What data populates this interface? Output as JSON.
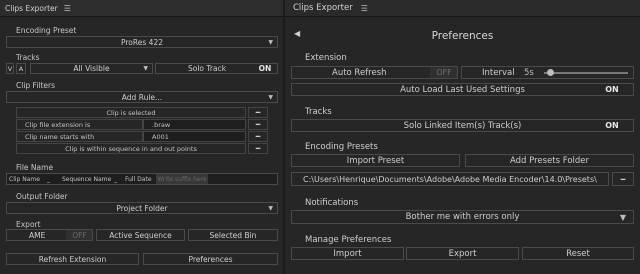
{
  "left": {
    "title": "Clips Exporter",
    "menu_glyph": "☰",
    "encoding_preset": {
      "label": "Encoding Preset",
      "value": "ProRes 422"
    },
    "tracks": {
      "label": "Tracks",
      "video": "V",
      "audio": "A",
      "visibility": "All Visible",
      "solo_label": "Solo Track",
      "solo_state": "ON"
    },
    "clip_filters": {
      "label": "Clip Filters",
      "add_rule": "Add Rule...",
      "rules": [
        {
          "text": "Clip is selected",
          "value": ""
        },
        {
          "text": "Clip file extension is",
          "value": ".braw"
        },
        {
          "text": "Clip name starts with",
          "value": "A001"
        },
        {
          "text": "Clip is within sequence in and out points",
          "value": ""
        }
      ],
      "remove_glyph": "━"
    },
    "file_name": {
      "label": "File Name",
      "tokens": [
        "Clip Name",
        "_",
        "Sequence Name",
        "_",
        "Full Date"
      ],
      "placeholder": "Write suffix here"
    },
    "output_folder": {
      "label": "Output Folder",
      "value": "Project Folder"
    },
    "export": {
      "label": "Export",
      "ame_label": "AME",
      "ame_state": "OFF",
      "active_sequence": "Active Sequence",
      "selected_bin": "Selected Bin"
    },
    "refresh_extension": "Refresh Extension",
    "preferences": "Preferences",
    "select_arrow": "▼"
  },
  "right": {
    "title": "Clips Exporter",
    "menu_glyph": "☰",
    "back_glyph": "◀",
    "heading": "Preferences",
    "extension": {
      "label": "Extension",
      "auto_refresh": "Auto Refresh",
      "auto_refresh_state": "OFF",
      "interval_label": "Interval",
      "interval_value": "5s",
      "interval_fraction": 0.08,
      "auto_load": "Auto Load Last Used Settings",
      "auto_load_state": "ON"
    },
    "tracks": {
      "label": "Tracks",
      "solo_linked": "Solo Linked Item(s) Track(s)",
      "solo_linked_state": "ON"
    },
    "encoding_presets": {
      "label": "Encoding Presets",
      "import": "Import Preset",
      "add_folder": "Add Presets Folder",
      "path": "C:\\Users\\Henrique\\Documents\\Adobe\\Adobe Media Encoder\\14.0\\Presets\\",
      "remove_glyph": "━"
    },
    "notifications": {
      "label": "Notifications",
      "value": "Bother me with errors only"
    },
    "manage": {
      "label": "Manage Preferences",
      "import": "Import",
      "export": "Export",
      "reset": "Reset"
    },
    "select_arrow": "▼"
  },
  "colors": {
    "panel": "#262626",
    "border": "#4a4a4a",
    "text": "#c8c8c8",
    "off_text": "#6e6e6e"
  }
}
